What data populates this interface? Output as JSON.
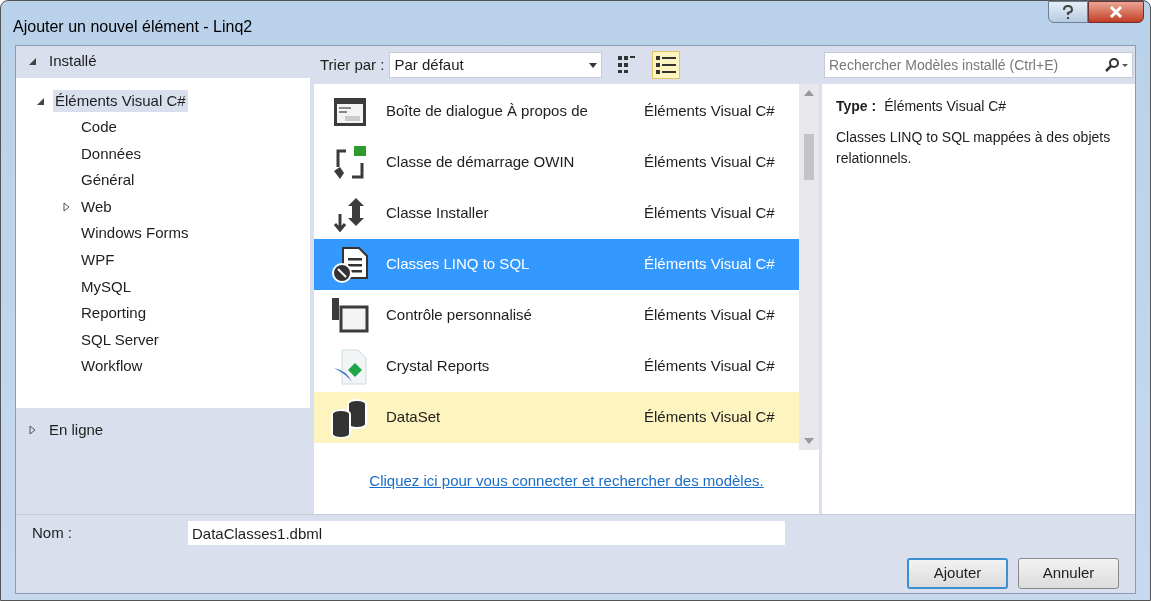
{
  "window": {
    "title": "Ajouter un nouvel élément - Linq2"
  },
  "sidebar": {
    "sections": [
      {
        "label": "Installé",
        "expanded": true,
        "children": [
          {
            "label": "Éléments Visual C#",
            "expanded": true,
            "selected": true,
            "children": [
              {
                "label": "Code",
                "selected": false
              },
              {
                "label": "Données",
                "selected": false
              },
              {
                "label": "Général",
                "selected": false
              },
              {
                "label": "Web",
                "selected": false,
                "expanded": false
              },
              {
                "label": "Windows Forms",
                "selected": false
              },
              {
                "label": "WPF",
                "selected": false
              },
              {
                "label": "MySQL",
                "selected": false
              },
              {
                "label": "Reporting",
                "selected": false
              },
              {
                "label": "SQL Server",
                "selected": false
              },
              {
                "label": "Workflow",
                "selected": false
              }
            ]
          }
        ]
      },
      {
        "label": "En ligne",
        "expanded": false
      }
    ]
  },
  "toolbar": {
    "sort_label": "Trier par :",
    "sort_value": "Par défaut",
    "views": [
      {
        "kind": "tiles",
        "selected": false
      },
      {
        "kind": "list",
        "selected": true
      }
    ]
  },
  "search": {
    "placeholder": "Rechercher Modèles installé (Ctrl+E)"
  },
  "templates": [
    {
      "kind": "about-dialog",
      "name": "Boîte de dialogue À propos de",
      "category": "Éléments Visual C#",
      "selected": false,
      "hovered": false
    },
    {
      "kind": "owin",
      "name": "Classe de démarrage OWIN",
      "category": "Éléments Visual C#",
      "selected": false,
      "hovered": false
    },
    {
      "kind": "installer",
      "name": "Classe Installer",
      "category": "Éléments Visual C#",
      "selected": false,
      "hovered": false
    },
    {
      "kind": "linq",
      "name": "Classes LINQ to SQL",
      "category": "Éléments Visual C#",
      "selected": true,
      "hovered": false
    },
    {
      "kind": "user-control",
      "name": "Contrôle personnalisé",
      "category": "Éléments Visual C#",
      "selected": false,
      "hovered": false
    },
    {
      "kind": "crystal",
      "name": "Crystal Reports",
      "category": "Éléments Visual C#",
      "selected": false,
      "hovered": false
    },
    {
      "kind": "dataset",
      "name": "DataSet",
      "category": "Éléments Visual C#",
      "selected": false,
      "hovered": true
    }
  ],
  "online_link": "Cliquez ici pour vous connecter et rechercher des modèles.",
  "details": {
    "type_label": "Type :",
    "type_value": "Éléments Visual C#",
    "description": "Classes LINQ to SQL mappées à des objets relationnels."
  },
  "name_field": {
    "label": "Nom :",
    "value": "DataClasses1.dbml"
  },
  "buttons": [
    {
      "label": "Ajouter",
      "default": true
    },
    {
      "label": "Annuler",
      "default": false
    }
  ]
}
